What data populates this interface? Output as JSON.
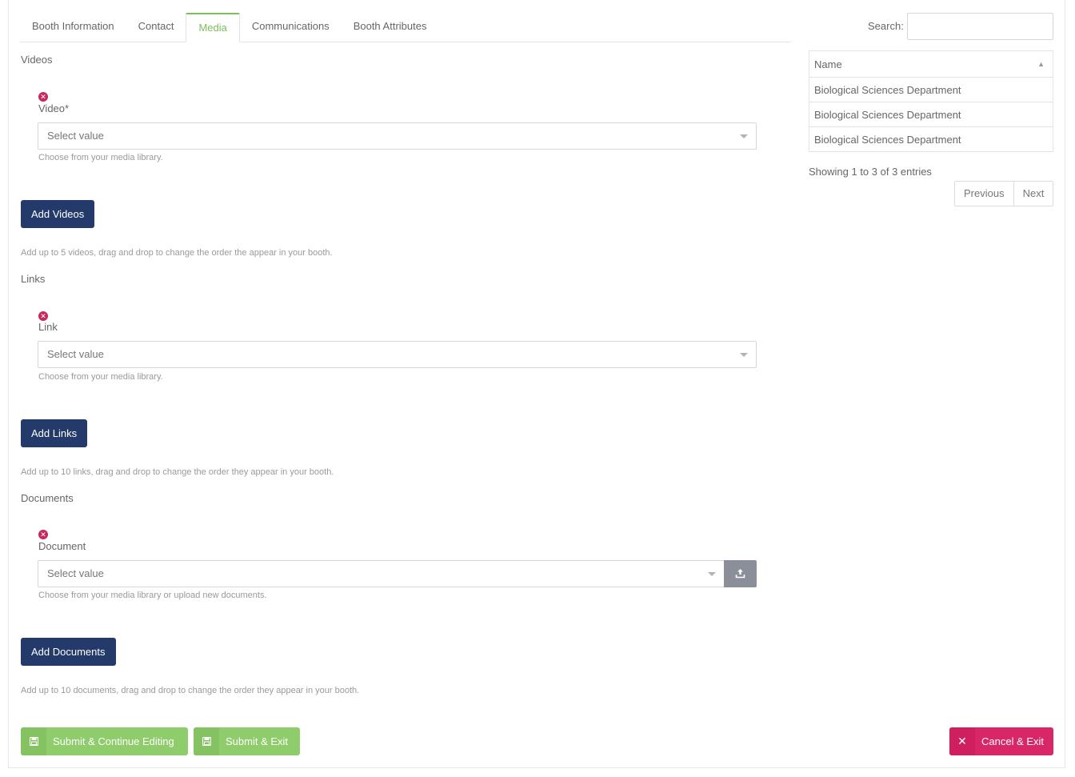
{
  "tabs": [
    {
      "label": "Booth Information"
    },
    {
      "label": "Contact"
    },
    {
      "label": "Media"
    },
    {
      "label": "Communications"
    },
    {
      "label": "Booth Attributes"
    }
  ],
  "videos": {
    "title": "Videos",
    "field_label": "Video*",
    "placeholder": "Select value",
    "help": "Choose from your media library.",
    "add_button": "Add Videos",
    "note": "Add up to 5 videos, drag and drop to change the order the appear in your booth."
  },
  "links": {
    "title": "Links",
    "field_label": "Link",
    "placeholder": "Select value",
    "help": "Choose from your media library.",
    "add_button": "Add Links",
    "note": "Add up to 10 links, drag and drop to change the order they appear in your booth."
  },
  "documents": {
    "title": "Documents",
    "field_label": "Document",
    "placeholder": "Select value",
    "help": "Choose from your media library or upload new documents.",
    "add_button": "Add Documents",
    "note": "Add up to 10 documents, drag and drop to change the order they appear in your booth."
  },
  "search": {
    "label": "Search:"
  },
  "table": {
    "header": "Name",
    "rows": [
      "Biological Sciences Department",
      "Biological Sciences Department",
      "Biological Sciences Department"
    ],
    "info": "Showing 1 to 3 of 3 entries",
    "previous": "Previous",
    "next": "Next"
  },
  "footer": {
    "submit_continue": "Submit & Continue Editing",
    "submit_exit": "Submit & Exit",
    "cancel_exit": "Cancel & Exit"
  },
  "colors": {
    "accent_green": "#7cbf5a",
    "navy": "#233a6b",
    "danger": "#d92667"
  }
}
